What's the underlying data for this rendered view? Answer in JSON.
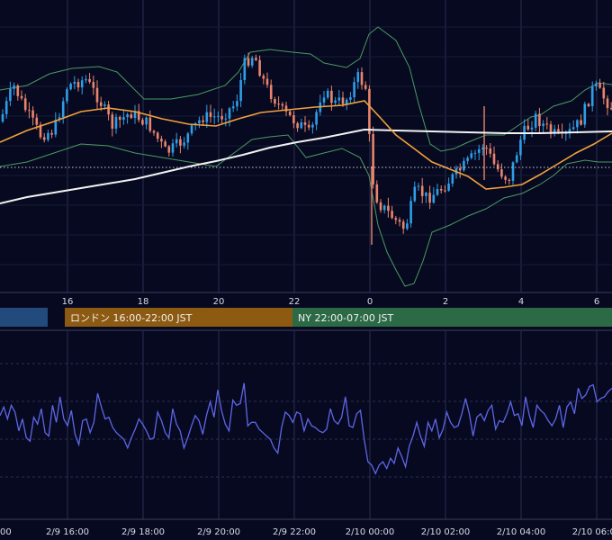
{
  "colors": {
    "background": "#070920",
    "grid": "#2a2f4f",
    "candle_up": "#2f9ee8",
    "candle_down": "#e9856c",
    "ma_short": "#f0a23b",
    "ma_long": "#f2f2f2",
    "bollinger": "#4a9a63",
    "rsi": "#5d66e6",
    "session_tokyo": "#234a7d",
    "session_london": "#8d5a12",
    "session_ny": "#2c6a46"
  },
  "sessions": [
    {
      "name": "tokyo",
      "label": ""
    },
    {
      "name": "london",
      "label": "ロンドン 16:00-22:00 JST"
    },
    {
      "name": "ny",
      "label": "NY 22:00-07:00 JST"
    }
  ],
  "chart_data": [
    {
      "type": "candlestick",
      "title": "",
      "x_tick_labels": [
        "16",
        "18",
        "20",
        "22",
        "0",
        "2",
        "4",
        "6"
      ],
      "overlays": [
        "moving-average-short",
        "moving-average-long",
        "bollinger-bands"
      ],
      "grid": true
    },
    {
      "type": "line",
      "title": "",
      "x_tick_labels": [
        "00",
        "2/9 16:00",
        "2/9 18:00",
        "2/9 20:00",
        "2/9 22:00",
        "2/10 00:00",
        "2/10 02:00",
        "2/10 04:00",
        "2/10 06:00"
      ],
      "series": [
        {
          "values": [
            57,
            62,
            55,
            63,
            59,
            48,
            55,
            44,
            42,
            56,
            52,
            61,
            47,
            45,
            63,
            53,
            68,
            55,
            51,
            60,
            46,
            40,
            54,
            55,
            47,
            53,
            70,
            62,
            55,
            56,
            50,
            47,
            45,
            43,
            38,
            44,
            49,
            55,
            52,
            48,
            43,
            44,
            59,
            54,
            47,
            44,
            61,
            52,
            48,
            38,
            44,
            51,
            57,
            54,
            46,
            57,
            65,
            56,
            72,
            60,
            52,
            48,
            66,
            63,
            64,
            76,
            51,
            53,
            53,
            49,
            47,
            45,
            43,
            38,
            35,
            50,
            59,
            57,
            53,
            59,
            58,
            48,
            55,
            51,
            50,
            48,
            47,
            49,
            61,
            54,
            52,
            56,
            68,
            51,
            50,
            58,
            60,
            43,
            30,
            28,
            23,
            28,
            30,
            26,
            32,
            29,
            38,
            33,
            27,
            39,
            45,
            53,
            45,
            39,
            53,
            48,
            55,
            44,
            49,
            59,
            53,
            50,
            51,
            58,
            67,
            58,
            45,
            56,
            58,
            54,
            60,
            63,
            49,
            54,
            53,
            58,
            65,
            57,
            58,
            51,
            68,
            57,
            50,
            63,
            60,
            58,
            54,
            51,
            55,
            63,
            50,
            62,
            65,
            58,
            73,
            67,
            69,
            74,
            75,
            65,
            67,
            68,
            71,
            73
          ]
        }
      ],
      "grid": true
    }
  ]
}
